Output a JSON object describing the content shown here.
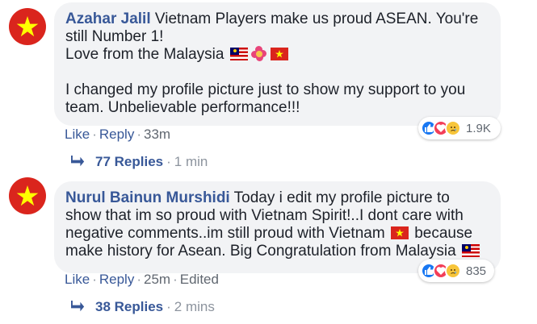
{
  "comments": [
    {
      "author": "Azahar Jalil",
      "text_line1": "Vietnam Players make us proud ASEAN. You're still Number 1!",
      "text_line2": "Love from the Malaysia",
      "text_para2": "I changed my profile picture just to show my support to you team. Unbelievable performance!!!",
      "like_label": "Like",
      "reply_label": "Reply",
      "time": "33m",
      "reaction_count": "1.9K",
      "replies_label": "77 Replies",
      "replies_time": "1 min"
    },
    {
      "author": "Nurul Bainun Murshidi",
      "text_part1": "Today i edit my profile picture to show that im so proud with Vietnam Spirit!..I dont care with negative comments..im still proud with Vietnam",
      "text_part2": "because make history for Asean. Big Congratulation from Malaysia",
      "like_label": "Like",
      "reply_label": "Reply",
      "time": "25m",
      "edited_label": "Edited",
      "reaction_count": "835",
      "replies_label": "38 Replies",
      "replies_time": "2 mins"
    }
  ],
  "icons": [
    "vietnam-flag-avatar",
    "malaysia-flag-icon",
    "hibiscus-icon",
    "vietnam-flag-icon",
    "like-reaction-icon",
    "love-reaction-icon",
    "sad-reaction-icon",
    "reply-arrow-icon"
  ],
  "colors": {
    "author": "#385898",
    "bubble": "#f2f3f5",
    "meta": "#606770",
    "vn_red": "#da251d",
    "vn_star": "#ffff00"
  }
}
